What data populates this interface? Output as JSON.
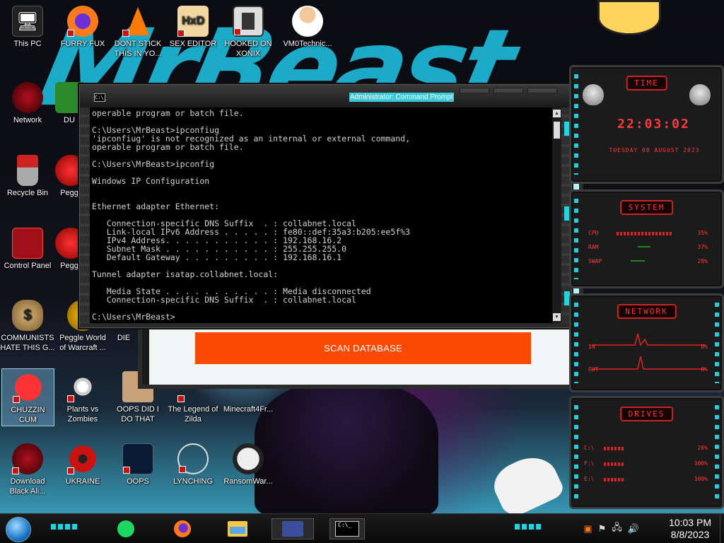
{
  "desktop": {
    "icons": [
      {
        "label": "This PC"
      },
      {
        "label": "FURRY FUX"
      },
      {
        "label": "DONT STICK THIS IN YO..."
      },
      {
        "label": "SEX EDITOR"
      },
      {
        "label": "HOOKED ON XONIX"
      },
      {
        "label": "VM0Technic..."
      },
      {
        "label": "Network"
      },
      {
        "label": "DU"
      },
      {
        "label": "Recycle Bin"
      },
      {
        "label": "Pegg"
      },
      {
        "label": "Control Panel"
      },
      {
        "label": "Pegg"
      },
      {
        "label": "COMMUNISTS HATE THIS G..."
      },
      {
        "label": "Peggle World of Warcraft ..."
      },
      {
        "label": "DIE"
      },
      {
        "label": "CHUZZIN CUM"
      },
      {
        "label": "Plants vs Zombies"
      },
      {
        "label": "OOPS DID I DO THAT"
      },
      {
        "label": "The Legend of Zilda"
      },
      {
        "label": "Minecraft4Fr..."
      },
      {
        "label": "Download Black Ali..."
      },
      {
        "label": "UKRAINE"
      },
      {
        "label": "OOPS"
      },
      {
        "label": "LYNCHING"
      },
      {
        "label": "RansomWar..."
      }
    ],
    "wallpaper_text": "MrBeast"
  },
  "app_window": {
    "scan_button_label": "SCAN DATABASE",
    "accent_color": "#fa4a05"
  },
  "cmd": {
    "title": "Administrator: Command Prompt",
    "icon_label": "C:\\_",
    "lines": [
      "operable program or batch file.",
      "",
      "C:\\Users\\MrBeast>ipconfiug",
      "'ipconfiug' is not recognized as an internal or external command,",
      "operable program or batch file.",
      "",
      "C:\\Users\\MrBeast>ipconfig",
      "",
      "Windows IP Configuration",
      "",
      "",
      "Ethernet adapter Ethernet:",
      "",
      "   Connection-specific DNS Suffix  . : collabnet.local",
      "   Link-local IPv6 Address . . . . . : fe80::def:35a3:b205:ee5f%3",
      "   IPv4 Address. . . . . . . . . . . : 192.168.16.2",
      "   Subnet Mask . . . . . . . . . . . : 255.255.255.0",
      "   Default Gateway . . . . . . . . . : 192.168.16.1",
      "",
      "Tunnel adapter isatap.collabnet.local:",
      "",
      "   Media State . . . . . . . . . . . : Media disconnected",
      "   Connection-specific DNS Suffix  . : collabnet.local",
      "",
      "C:\\Users\\MrBeast>"
    ]
  },
  "gadgets": {
    "time": {
      "title": "TIME",
      "time": "22:03:02",
      "date": "TUESDAY 08 AUGUST 2023"
    },
    "system": {
      "title": "SYSTEM",
      "rows": [
        {
          "label": "CPU",
          "value": "35%"
        },
        {
          "label": "RAM",
          "value": "37%"
        },
        {
          "label": "SWAP",
          "value": "28%"
        }
      ]
    },
    "network": {
      "title": "NETWORK",
      "rows": [
        {
          "label": "IN",
          "value": "0%"
        },
        {
          "label": "OUT",
          "value": "0%"
        }
      ]
    },
    "drives": {
      "title": "DRIVES",
      "rows": [
        {
          "label": "C:\\",
          "value": "26%"
        },
        {
          "label": "F:\\",
          "value": "100%"
        },
        {
          "label": "E:\\",
          "value": "100%"
        }
      ]
    },
    "accent_color": "#ff3a3a"
  },
  "taskbar": {
    "apps": [
      {
        "name": "Spotify"
      },
      {
        "name": "Firefox"
      },
      {
        "name": "File Explorer"
      },
      {
        "name": "Gadget"
      },
      {
        "name": "Command Prompt",
        "icon_text": "C:\\_"
      }
    ],
    "tray": {
      "icons": [
        "office-icon",
        "flag-icon",
        "network-icon",
        "volume-icon"
      ]
    },
    "clock": {
      "time": "10:03 PM",
      "date": "8/8/2023"
    }
  }
}
